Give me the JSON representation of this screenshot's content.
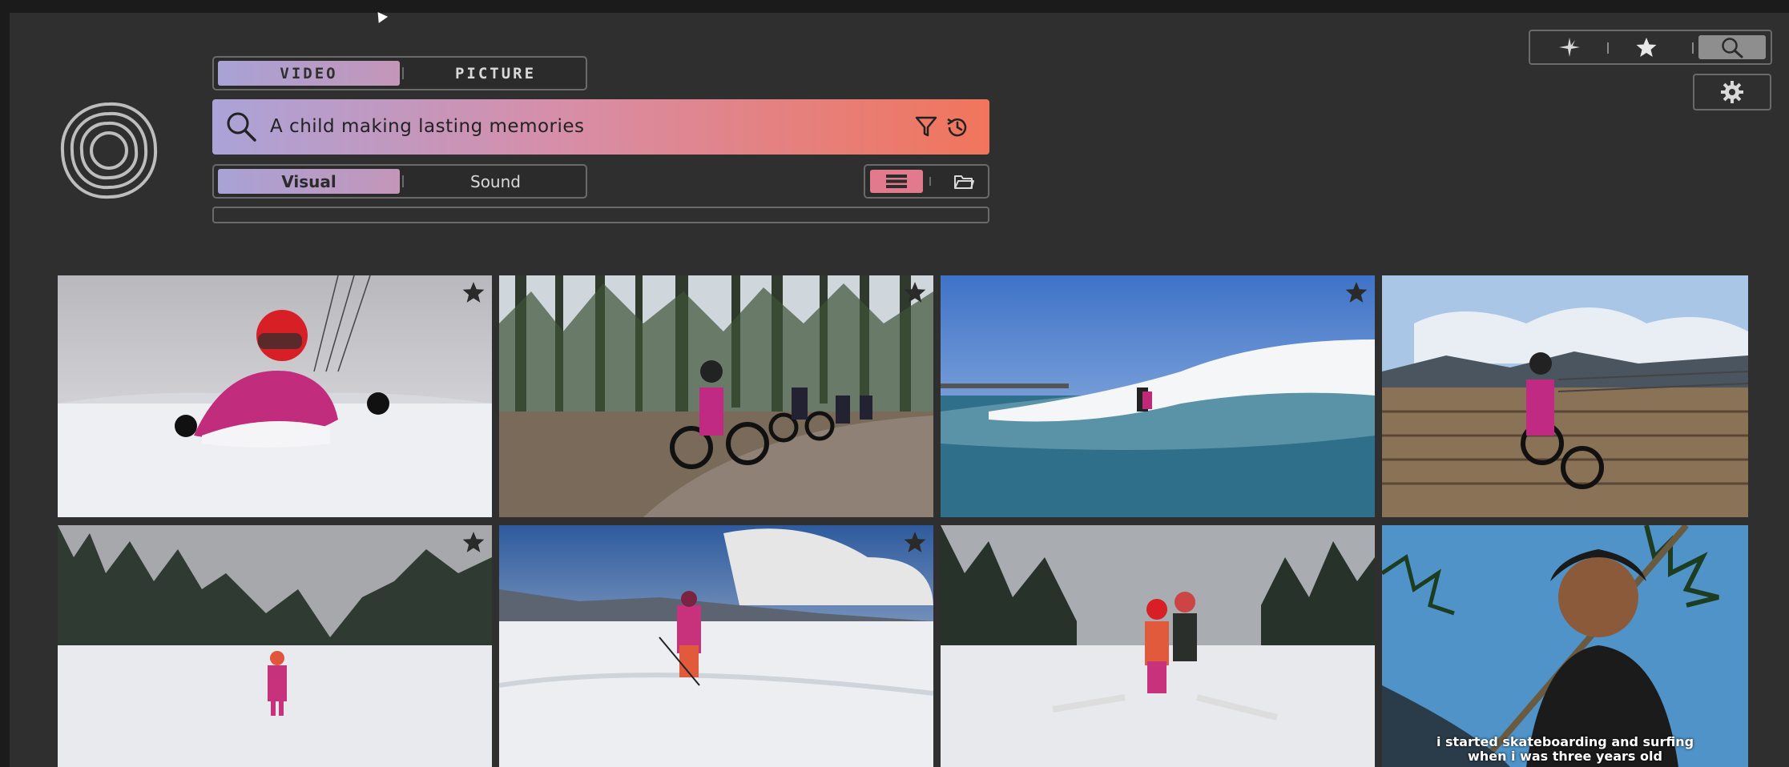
{
  "media_tabs": [
    {
      "label": "VIDEO",
      "selected": true
    },
    {
      "label": "PICTURE",
      "selected": false
    }
  ],
  "search": {
    "query": "A child making lasting memories"
  },
  "modality_tabs": [
    {
      "label": "Visual",
      "selected": true
    },
    {
      "label": "Sound",
      "selected": false
    }
  ],
  "view_toggle": {
    "active": "list-view",
    "other": "folder-view"
  },
  "right_nav": {
    "active": "search"
  },
  "results": [
    {
      "scene": "child skiing in snow, red helmet, pink jacket",
      "starred": true
    },
    {
      "scene": "kids riding bikes on forest trail",
      "starred": true
    },
    {
      "scene": "surfer riding a wave",
      "starred": true
    },
    {
      "scene": "child riding bike on wooden boardwalk",
      "starred": false
    },
    {
      "scene": "child skiing down slope near pine trees",
      "starred": true
    },
    {
      "scene": "child skiing under cloudy mountain sky",
      "starred": true
    },
    {
      "scene": "adult and child skiing together",
      "starred": false
    },
    {
      "scene": "smiling child with palm trees",
      "starred": false,
      "caption_line1": "i started skateboarding and surfing",
      "caption_line2": "when i was three years old"
    }
  ],
  "colors": {
    "background": "#2f2f2f",
    "accent_gradient_start": "#aba3d8",
    "accent_gradient_end": "#f1755b",
    "list_view_active": "#e07a8c"
  }
}
